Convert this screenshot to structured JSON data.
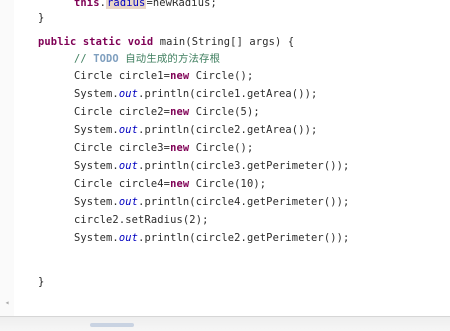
{
  "code": {
    "line_1": {
      "kw": "this",
      "dot": ".",
      "field": "radius",
      "rest": "=newRadius;"
    },
    "line_2": "}",
    "line_3": {
      "kw1": "public",
      "kw2": "static",
      "kw3": "void",
      "rest": "main(String[] args) {"
    },
    "line_4": {
      "slashes": "// ",
      "todo": "TODO",
      "text": "自动生成的方法存根"
    },
    "line_5": {
      "pre": "Circle circle1=",
      "kw": "new",
      "post": " Circle();"
    },
    "line_6": {
      "pre": "System.",
      "field": "out",
      "post": ".println(circle1.getArea());"
    },
    "line_7": {
      "pre": "Circle circle2=",
      "kw": "new",
      "post": " Circle(5);"
    },
    "line_8": {
      "pre": "System.",
      "field": "out",
      "post": ".println(circle2.getArea());"
    },
    "line_9": {
      "pre": "Circle circle3=",
      "kw": "new",
      "post": " Circle();"
    },
    "line_10": {
      "pre": "System.",
      "field": "out",
      "post": ".println(circle3.getPerimeter());"
    },
    "line_11": {
      "pre": "Circle circle4=",
      "kw": "new",
      "post": " Circle(10);"
    },
    "line_12": {
      "pre": "System.",
      "field": "out",
      "post": ".println(circle4.getPerimeter());"
    },
    "line_13": "circle2.setRadius(2);",
    "line_14": {
      "pre": "System.",
      "field": "out",
      "post": ".println(circle2.getPerimeter());"
    },
    "line_15": "}"
  },
  "colors": {
    "keyword": "#7f0055",
    "field": "#0000c0",
    "comment": "#3f7f5f",
    "todo": "#7f9fbf",
    "highlight": "#e8d6c8"
  }
}
